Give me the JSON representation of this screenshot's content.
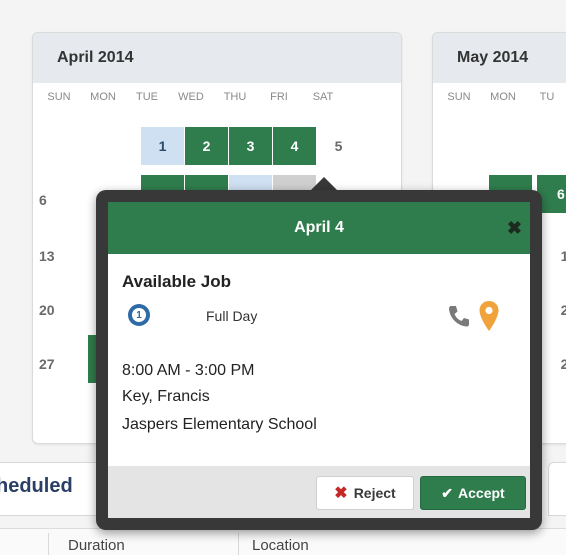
{
  "calendars": [
    {
      "month": "April 2014",
      "weekdays": [
        "SUN",
        "MON",
        "TUE",
        "WED",
        "THU",
        "FRI",
        "SAT"
      ],
      "visible_days": [
        "1",
        "2",
        "3",
        "4",
        "5",
        "6",
        "13",
        "20",
        "27"
      ]
    },
    {
      "month": "May 2014",
      "weekdays": [
        "SUN",
        "MON",
        "TU"
      ],
      "visible_days": [
        "6",
        "1",
        "2",
        "2"
      ]
    }
  ],
  "popup": {
    "date": "April 4",
    "close_glyph": "✖",
    "job_title": "Available Job",
    "badge_number": "1",
    "duration": "Full Day",
    "time": "8:00 AM - 3:00 PM",
    "contact": "Key, Francis",
    "school": "Jaspers Elementary School",
    "reject_label": "Reject",
    "accept_label": "Accept"
  },
  "section": {
    "title": "heduled"
  },
  "table": {
    "headers": [
      "Duration",
      "Location"
    ]
  },
  "colors": {
    "green": "#2f7d4d",
    "blue": "#2e6aa6",
    "orange": "#f0a33a",
    "red": "#c62828"
  }
}
